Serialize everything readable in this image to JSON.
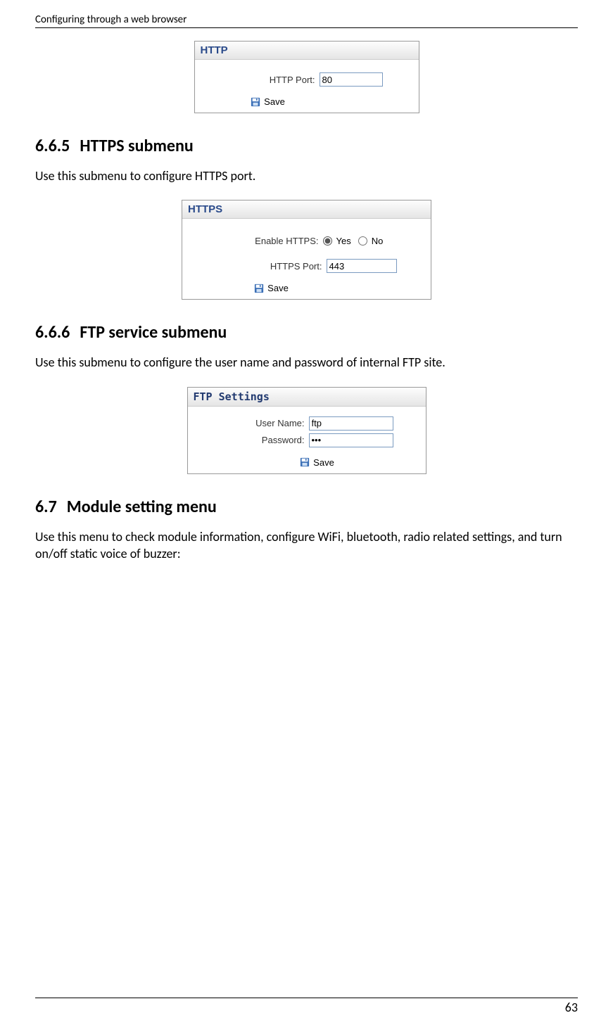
{
  "header": "Configuring through a web browser",
  "page_number": "63",
  "http_panel": {
    "title": "HTTP",
    "port_label": "HTTP Port:",
    "port_value": "80",
    "save_label": "Save"
  },
  "section_665": {
    "num": "6.6.5",
    "title": "HTTPS submenu",
    "body": "Use this submenu to configure HTTPS port."
  },
  "https_panel": {
    "title": "HTTPS",
    "enable_label": "Enable HTTPS:",
    "yes_label": "Yes",
    "no_label": "No",
    "port_label": "HTTPS Port:",
    "port_value": "443",
    "save_label": "Save"
  },
  "section_666": {
    "num": "6.6.6",
    "title": "FTP service submenu",
    "body": "Use this submenu to configure the user name and password of internal FTP site."
  },
  "ftp_panel": {
    "title": "FTP Settings",
    "user_label": "User Name:",
    "user_value": "ftp",
    "pass_label": "Password:",
    "pass_value": "•••",
    "save_label": "Save"
  },
  "section_67": {
    "num": "6.7",
    "title": "Module setting menu",
    "body": "Use this menu to check module information, configure WiFi, bluetooth, radio related settings, and turn on/off static voice of buzzer:"
  }
}
